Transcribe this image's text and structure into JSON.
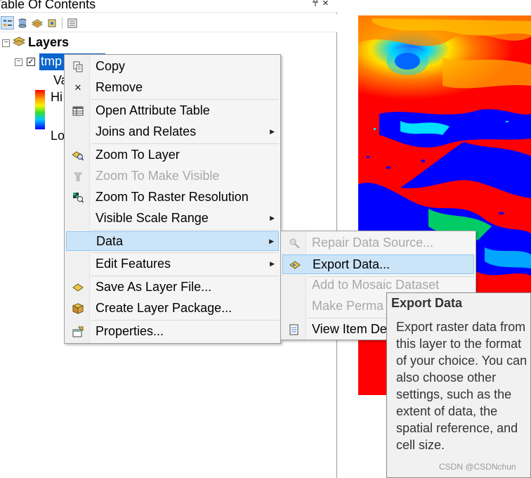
{
  "toc": {
    "title": "Table Of Contents",
    "pin_glyph": "❁",
    "close_glyph": "×",
    "toolbar": [
      "list-by-drawing-order-icon",
      "list-by-source-icon",
      "list-by-visibility-icon",
      "list-by-selection-icon",
      "options-icon"
    ],
    "layers_label": "Layers",
    "layer_name": "tmp",
    "value_label": "Va",
    "legend_high": "Hi",
    "legend_low": "Lo",
    "checkbox_glyph": "✓",
    "expander_glyph": "−"
  },
  "context_menu": {
    "items": [
      {
        "label": "Copy",
        "icon": "copy-icon"
      },
      {
        "label": "Remove",
        "icon": "remove-icon",
        "glyph": "✕"
      },
      {
        "label": "Open Attribute Table",
        "icon": "table-icon"
      },
      {
        "label": "Joins and Relates",
        "submenu": true
      },
      {
        "label": "Zoom To Layer",
        "icon": "zoom-to-layer-icon"
      },
      {
        "label": "Zoom To Make Visible",
        "icon": "zoom-visible-icon",
        "disabled": true
      },
      {
        "label": "Zoom To Raster Resolution",
        "icon": "raster-resolution-icon"
      },
      {
        "label": "Visible Scale Range",
        "submenu": true
      },
      {
        "label": "Data",
        "submenu": true,
        "highlighted": true
      },
      {
        "label": "Edit Features",
        "submenu": true
      },
      {
        "label": "Save As Layer File...",
        "icon": "layer-file-icon"
      },
      {
        "label": "Create Layer Package...",
        "icon": "layer-package-icon"
      },
      {
        "label": "Properties...",
        "icon": "properties-icon"
      }
    ],
    "arrow_glyph": "▶"
  },
  "data_submenu": {
    "items": [
      {
        "label": "Repair Data Source...",
        "icon": "repair-icon",
        "disabled": true
      },
      {
        "label": "Export Data...",
        "icon": "export-icon",
        "highlighted": true
      },
      {
        "label": "Add to Mosaic Dataset",
        "disabled": true
      },
      {
        "label": "Make Perma",
        "disabled": true
      },
      {
        "label": "View Item De",
        "icon": "view-item-icon"
      }
    ]
  },
  "tooltip": {
    "title": "Export Data",
    "body": "Export raster data from this layer to the format of your choice. You can also choose other settings, such as the extent of data, the spatial reference, and cell size."
  },
  "watermark": "CSDN @CSDNchun",
  "colors": {
    "selection": "#0a64cc",
    "menu_hover": "#cce4f7",
    "map_red": "#ff0000",
    "map_blue": "#0000ff"
  }
}
